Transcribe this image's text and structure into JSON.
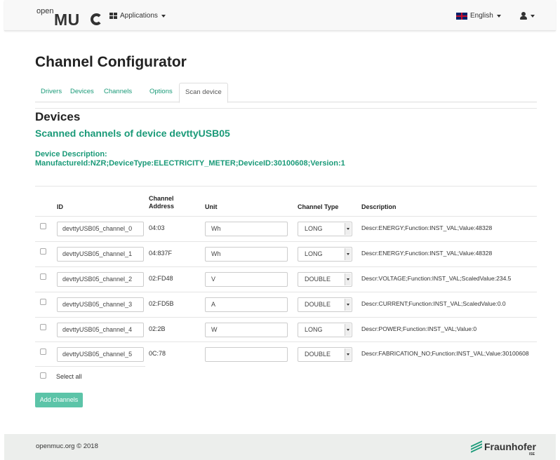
{
  "navbar": {
    "brand_small": "open",
    "brand_big": "MU",
    "applications_label": "Applications",
    "language_label": "English"
  },
  "page": {
    "title": "Channel Configurator"
  },
  "tabs": [
    {
      "label": "Drivers",
      "active": false
    },
    {
      "label": "Devices",
      "active": false
    },
    {
      "label": "Channels",
      "active": false
    },
    {
      "label": "Options",
      "active": false
    },
    {
      "label": "Scan device",
      "active": true
    }
  ],
  "devices": {
    "heading": "Devices",
    "scanned_heading": "Scanned channels of device devttyUSB05",
    "description_label": "Device Description:",
    "description_value": "ManufactureId:NZR;DeviceType:ELECTRICITY_METER;DeviceID:30100608;Version:1"
  },
  "table": {
    "headers": {
      "id": "ID",
      "channel_address_line1": "Channel",
      "channel_address_line2": "Address",
      "unit": "Unit",
      "channel_type": "Channel Type",
      "description": "Description"
    },
    "rows": [
      {
        "checked": false,
        "id": "devttyUSB05_channel_0",
        "address": "04:03",
        "unit": "Wh",
        "type": "LONG",
        "description": "Descr:ENERGY;Function:INST_VAL;Value:48328"
      },
      {
        "checked": false,
        "id": "devttyUSB05_channel_1",
        "address": "04:837F",
        "unit": "Wh",
        "type": "LONG",
        "description": "Descr:ENERGY;Function:INST_VAL;Value:48328"
      },
      {
        "checked": false,
        "id": "devttyUSB05_channel_2",
        "address": "02:FD48",
        "unit": "V",
        "type": "DOUBLE",
        "description": "Descr:VOLTAGE;Function:INST_VAL;ScaledValue:234.5"
      },
      {
        "checked": false,
        "id": "devttyUSB05_channel_3",
        "address": "02:FD5B",
        "unit": "A",
        "type": "DOUBLE",
        "description": "Descr:CURRENT;Function:INST_VAL;ScaledValue:0.0"
      },
      {
        "checked": false,
        "id": "devttyUSB05_channel_4",
        "address": "02:2B",
        "unit": "W",
        "type": "LONG",
        "description": "Descr:POWER;Function:INST_VAL;Value:0"
      },
      {
        "checked": false,
        "id": "devttyUSB05_channel_5",
        "address": "0C:78",
        "unit": "",
        "type": "DOUBLE",
        "description": "Descr:FABRICATION_NO;Function:INST_VAL;Value:30100608"
      }
    ],
    "select_all_label": "Select all"
  },
  "actions": {
    "add_channels_label": "Add channels"
  },
  "footer": {
    "copyright": "openmuc.org © 2018",
    "logo_text": "Fraunhofer",
    "logo_sub": "ISE"
  },
  "colors": {
    "accent": "#1a9a78",
    "button": "#5cc4a8",
    "navbar_bg": "#f8f8f8",
    "footer_bg": "#eceeec"
  }
}
